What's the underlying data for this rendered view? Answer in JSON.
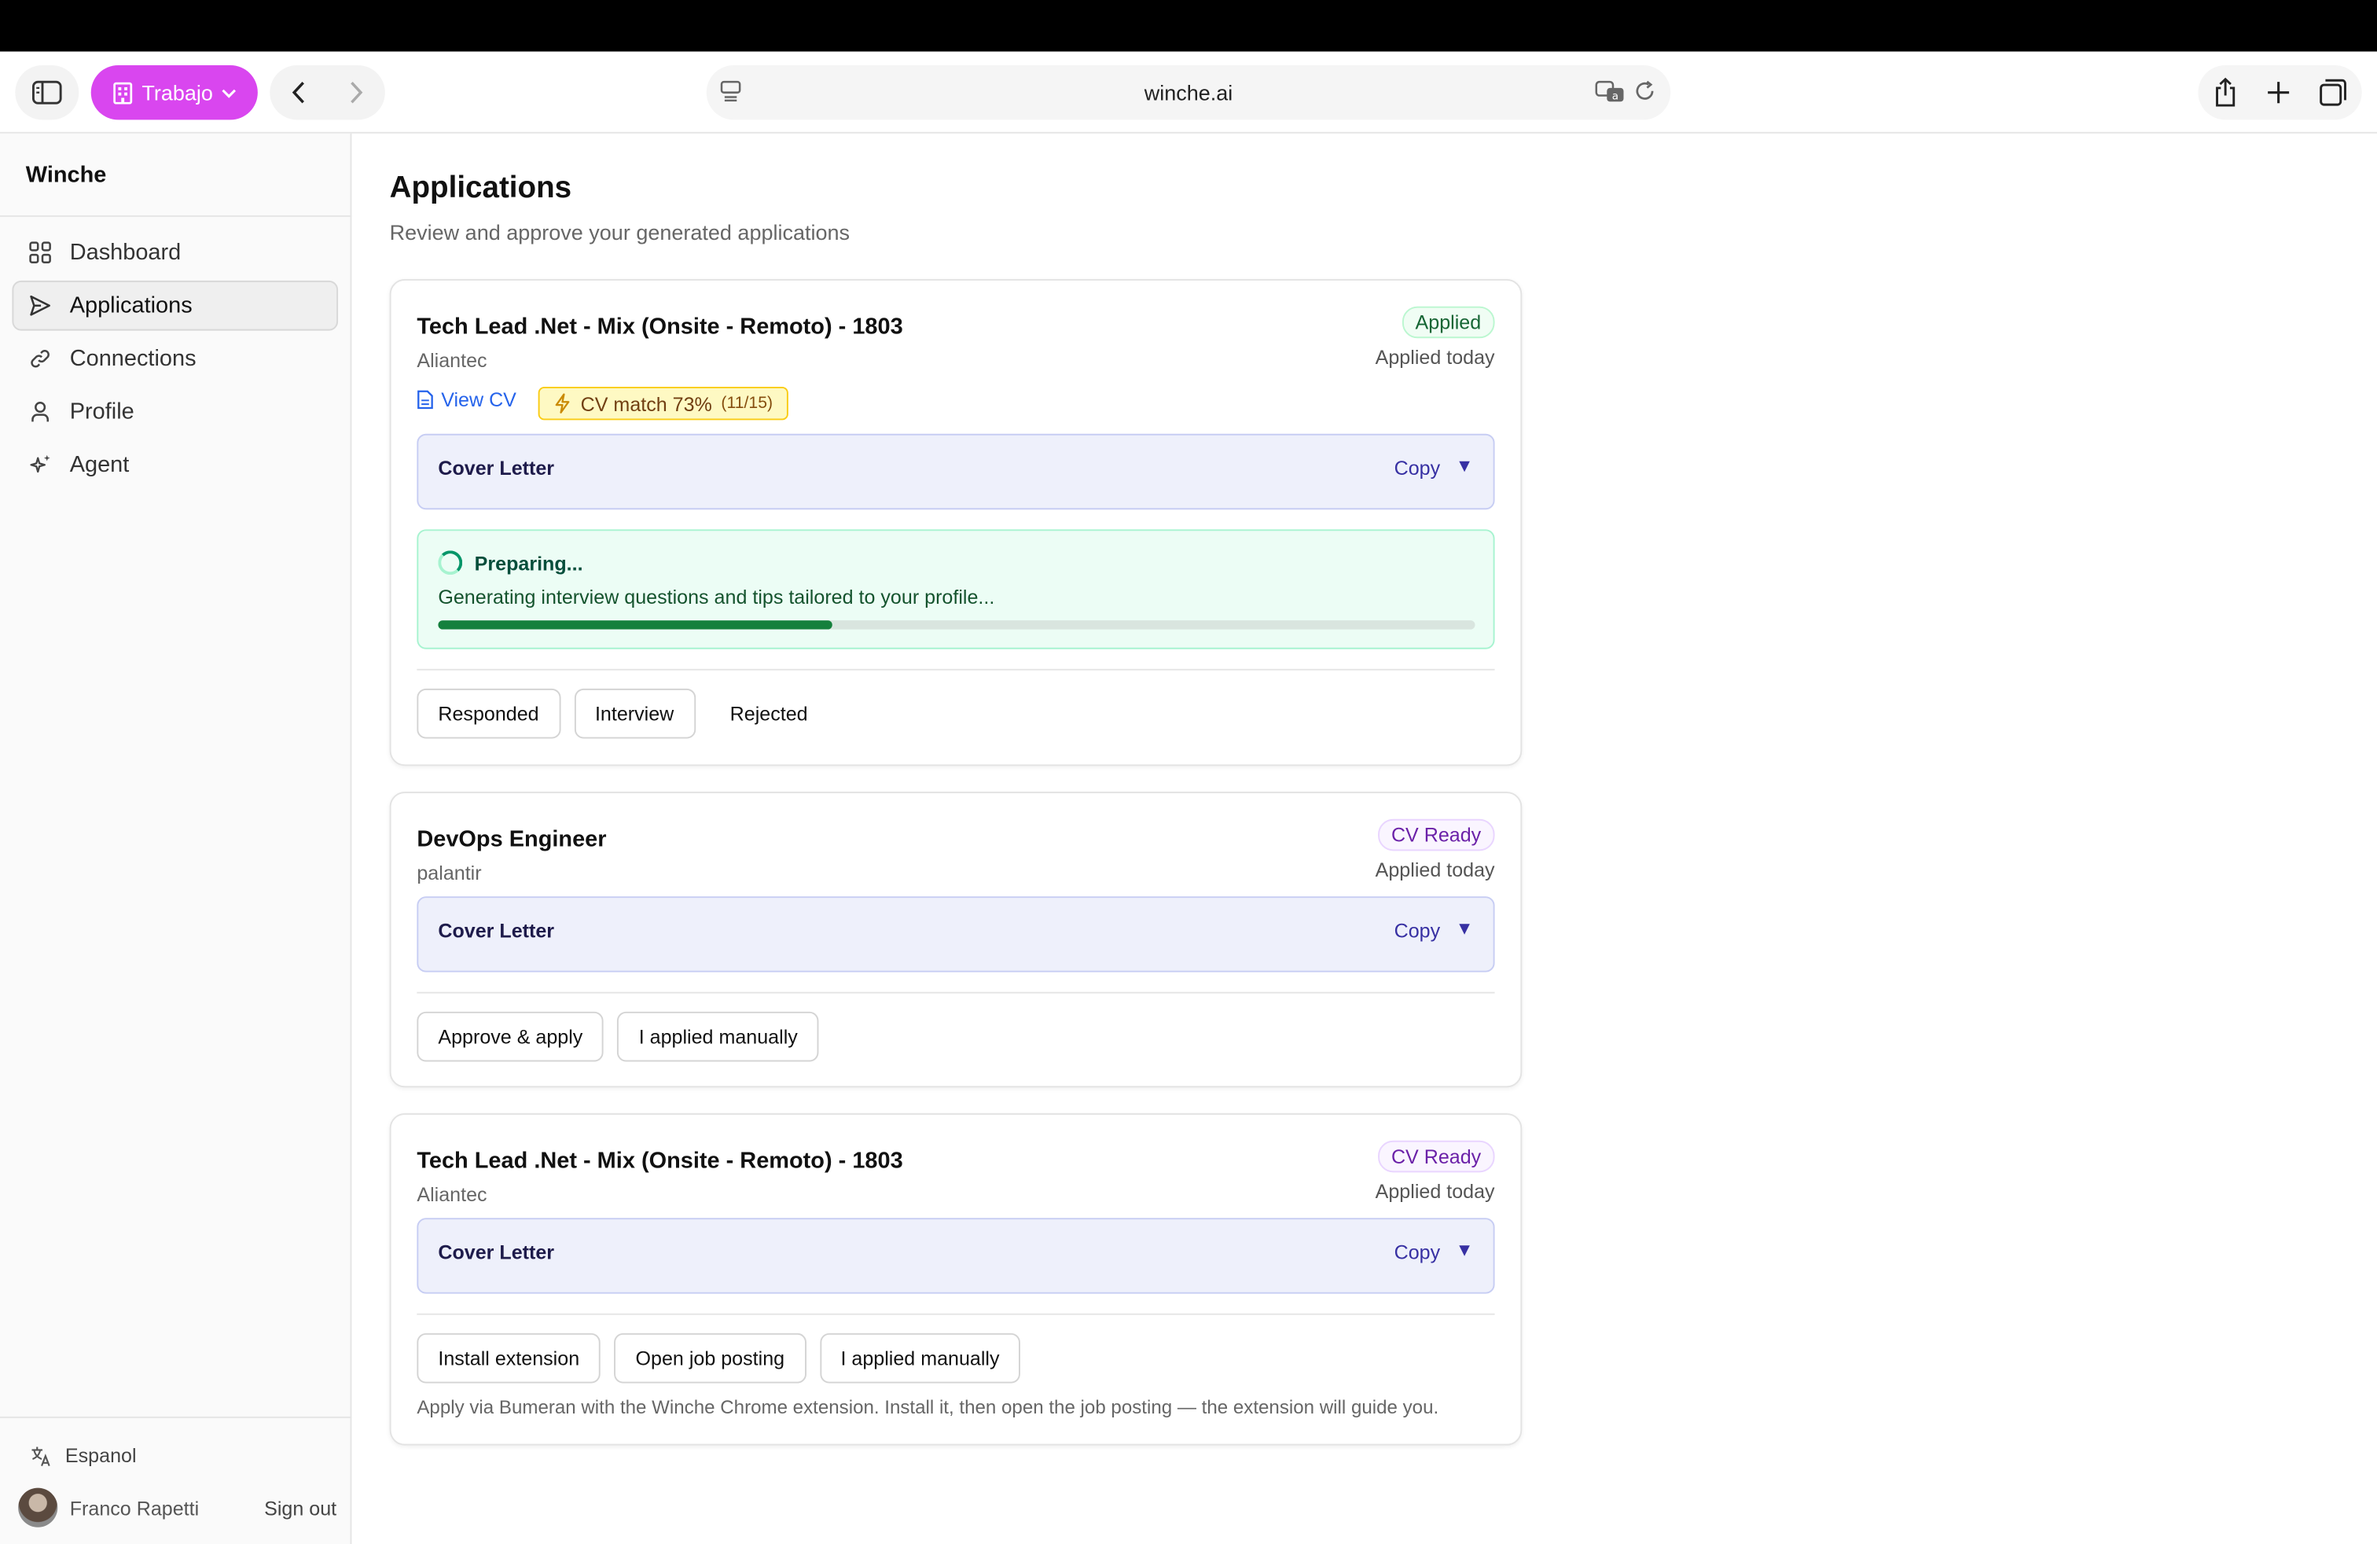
{
  "browser": {
    "profile_label": "Trabajo",
    "url": "winche.ai"
  },
  "sidebar": {
    "brand": "Winche",
    "items": [
      {
        "label": "Dashboard",
        "icon": "grid-icon"
      },
      {
        "label": "Applications",
        "icon": "send-icon"
      },
      {
        "label": "Connections",
        "icon": "link-icon"
      },
      {
        "label": "Profile",
        "icon": "user-icon"
      },
      {
        "label": "Agent",
        "icon": "sparkles-icon"
      }
    ],
    "active": "Applications",
    "language": "Espanol",
    "user_name": "Franco Rapetti",
    "sign_out": "Sign out"
  },
  "main": {
    "title": "Applications",
    "subtitle": "Review and approve your generated applications"
  },
  "cards": [
    {
      "title": "Tech Lead .Net - Mix (Onsite - Remoto) - 1803",
      "company": "Aliantec",
      "badge": "Applied",
      "when": "Applied today",
      "view_cv": "View CV",
      "match_label": "CV match 73%",
      "match_detail": "(11/15)",
      "cover_label": "Cover Letter",
      "copy_label": "Copy",
      "caret": "▼",
      "prep_title": "Preparing...",
      "prep_desc": "Generating interview questions and tips tailored to your profile...",
      "prep_progress": 0.38,
      "actions": [
        "Responded",
        "Interview",
        "Rejected"
      ]
    },
    {
      "title": "DevOps Engineer",
      "company": "palantir",
      "badge": "CV Ready",
      "when": "Applied today",
      "cover_label": "Cover Letter",
      "copy_label": "Copy",
      "caret": "▼",
      "actions": [
        "Approve & apply",
        "I applied manually"
      ]
    },
    {
      "title": "Tech Lead .Net - Mix (Onsite - Remoto) - 1803",
      "company": "Aliantec",
      "badge": "CV Ready",
      "when": "Applied today",
      "cover_label": "Cover Letter",
      "copy_label": "Copy",
      "caret": "▼",
      "actions": [
        "Install extension",
        "Open job posting",
        "I applied manually"
      ],
      "hint": "Apply via Bumeran with the Winche Chrome extension. Install it, then open the job posting — the extension will guide you."
    }
  ],
  "colors": {
    "profile_pill": "#d946ef",
    "applied_badge": "#166534",
    "cvready_badge": "#6b21a8",
    "progress": "#15803d"
  }
}
